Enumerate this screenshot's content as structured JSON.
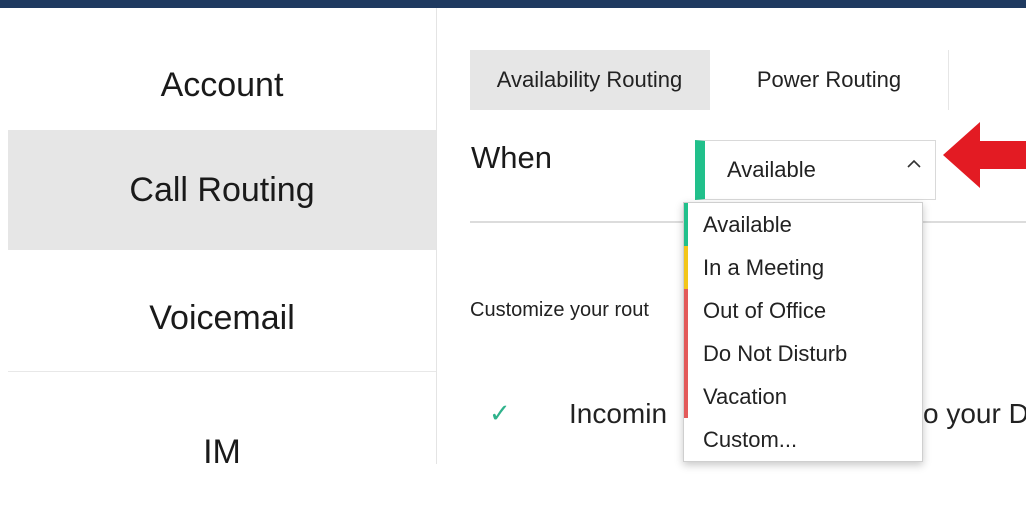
{
  "sidebar": {
    "items": [
      {
        "label": "Account"
      },
      {
        "label": "Call Routing"
      },
      {
        "label": "Voicemail"
      },
      {
        "label": "IM"
      }
    ]
  },
  "tabs": [
    {
      "label": "Availability Routing"
    },
    {
      "label": "Power Routing"
    }
  ],
  "when": {
    "label": "When",
    "selected": "Available",
    "selected_color": "#21c08b"
  },
  "dropdown": {
    "options": [
      {
        "label": "Available",
        "color": "#21c08b"
      },
      {
        "label": "In a Meeting",
        "color": "#f3c619"
      },
      {
        "label": "Out of Office",
        "color": "#e35a5a"
      },
      {
        "label": "Do Not Disturb",
        "color": "#e35a5a"
      },
      {
        "label": "Vacation",
        "color": "#e35a5a"
      },
      {
        "label": "Custom...",
        "color": "#ffffff"
      }
    ]
  },
  "content": {
    "customize_text": "Customize your rout",
    "incoming_left": "Incomin",
    "incoming_right": "o your D"
  },
  "icons": {
    "chevron": "chevron-up-icon",
    "arrow": "red-arrow-icon",
    "check": "check-icon"
  },
  "colors": {
    "top_bar": "#1f3a60",
    "accent_red": "#e31b23",
    "check_green": "#2fb28b"
  }
}
